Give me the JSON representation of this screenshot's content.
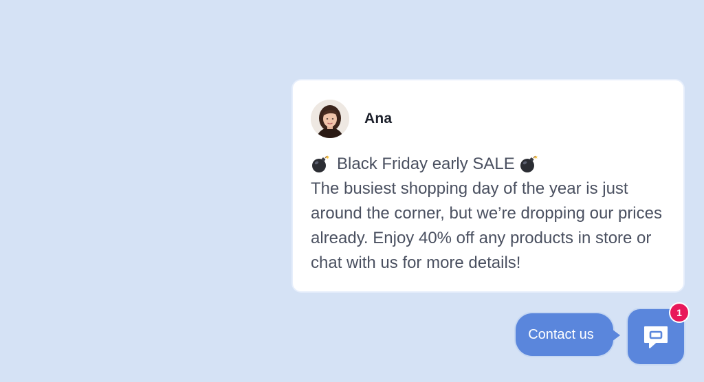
{
  "message": {
    "author_name": "Ana",
    "headline": "Black Friday early SALE",
    "body": "The busiest shopping day of the year is just around the corner, but we’re dropping our prices already. Enjoy 40% off any products in store or chat with us for more details!",
    "headline_icons": [
      "bomb-icon",
      "bomb-icon"
    ]
  },
  "launcher": {
    "contact_label": "Contact us",
    "badge_count": "1",
    "icon": "chat-icon"
  },
  "colors": {
    "background": "#d5e2f5",
    "accent": "#5a86dc",
    "badge": "#e8185a",
    "card": "#ffffff"
  }
}
